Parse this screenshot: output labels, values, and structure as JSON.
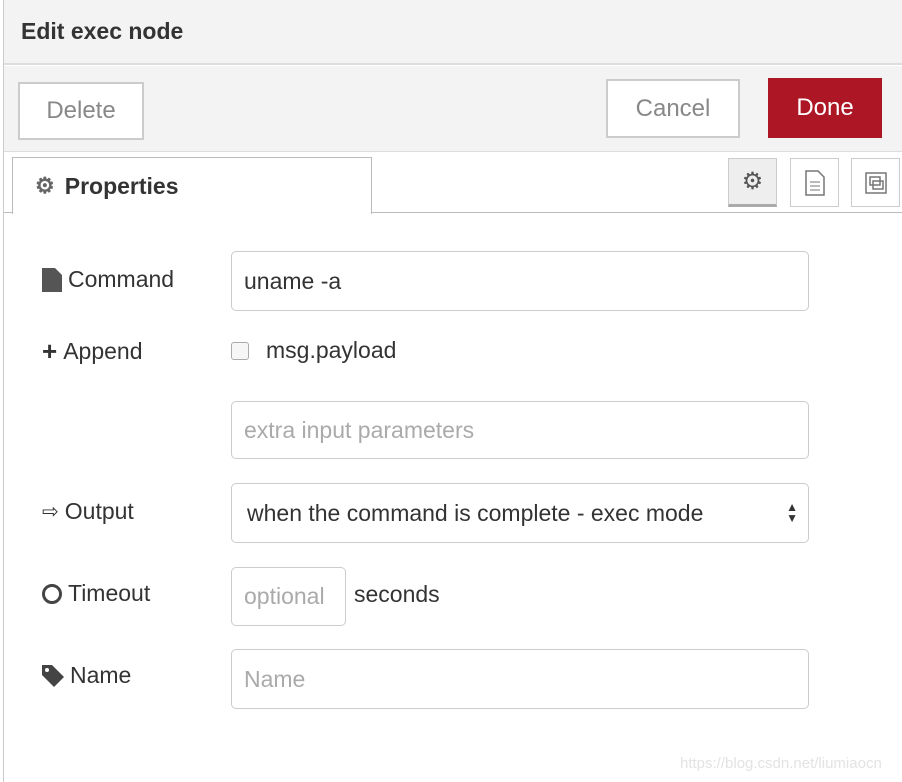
{
  "header": {
    "title": "Edit exec node"
  },
  "toolbar": {
    "delete": "Delete",
    "cancel": "Cancel",
    "done": "Done",
    "accent": "#ad1625"
  },
  "tabs": {
    "properties": "Properties",
    "icons": [
      "gear-icon",
      "description-icon",
      "appearance-icon"
    ]
  },
  "form": {
    "command": {
      "label": "Command",
      "value": "uname -a"
    },
    "append": {
      "label": "Append",
      "checkbox_label": "msg.payload",
      "checked": false,
      "extra_placeholder": "extra input parameters"
    },
    "output": {
      "label": "Output",
      "value": "when the command is complete - exec mode"
    },
    "timeout": {
      "label": "Timeout",
      "placeholder": "optional",
      "unit": "seconds"
    },
    "name": {
      "label": "Name",
      "placeholder": "Name"
    }
  },
  "watermark": "https://blog.csdn.net/liumiaocn"
}
